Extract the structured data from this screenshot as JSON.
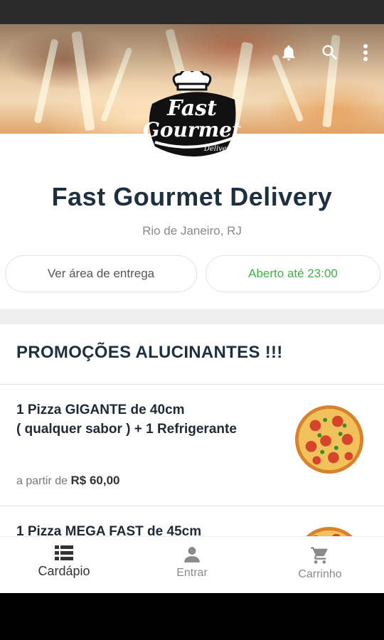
{
  "header": {
    "icons": [
      "bell-icon",
      "search-icon",
      "more-vert-icon"
    ]
  },
  "store": {
    "logo_text_line1": "Fast",
    "logo_text_line2": "Gourmet",
    "logo_text_line3": "Delivery",
    "name": "Fast Gourmet Delivery",
    "city": "Rio de Janeiro, RJ",
    "delivery_area_label": "Ver área de entrega",
    "open_status": "Aberto até 23:00",
    "open_color": "#3cb543"
  },
  "section": {
    "title": "PROMOÇÕES ALUCINANTES !!!"
  },
  "products": [
    {
      "name_line1": "1 Pizza GIGANTE de 40cm",
      "name_line2": "( qualquer sabor ) + 1 Refrigerante",
      "price_prefix": "a partir de",
      "price": "R$ 60,00"
    },
    {
      "name_line1": "1 Pizza MEGA FAST de 45cm"
    }
  ],
  "nav": [
    {
      "label": "Cardápio",
      "icon": "menu-list-icon",
      "active": true
    },
    {
      "label": "Entrar",
      "icon": "person-icon",
      "active": false
    },
    {
      "label": "Carrinho",
      "icon": "cart-icon",
      "active": false
    }
  ],
  "colors": {
    "title": "#1e3040",
    "active_nav": "#333333",
    "inactive_nav": "#8a8a8a"
  }
}
